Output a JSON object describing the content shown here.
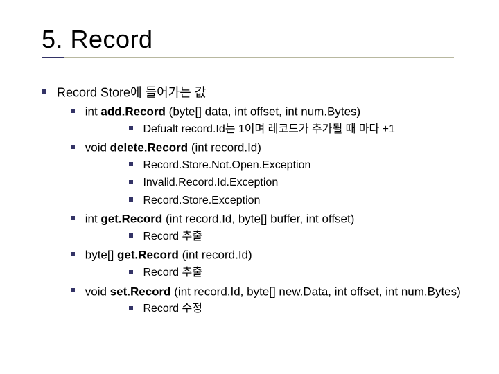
{
  "title": "5. Record",
  "lvl0": {
    "text": "Record Store에 들어가는 값"
  },
  "items": [
    {
      "sig_pre": "int ",
      "method": "add.Record",
      "sig_post": " (byte[] data, int offset, int num.Bytes)",
      "sub": [
        "Defualt record.Id는 1이며 레코드가 추가될 때 마다 +1"
      ]
    },
    {
      "sig_pre": "void ",
      "method": "delete.Record",
      "sig_post": " (int record.Id)",
      "sub": [
        "Record.Store.Not.Open.Exception",
        "Invalid.Record.Id.Exception",
        "Record.Store.Exception"
      ]
    },
    {
      "sig_pre": "int ",
      "method": "get.Record",
      "sig_post": " (int record.Id, byte[] buffer, int offset)",
      "sub": [
        "Record 추출"
      ]
    },
    {
      "sig_pre": "byte[] ",
      "method": "get.Record",
      "sig_post": " (int record.Id)",
      "sub": [
        "Record 추출"
      ]
    },
    {
      "sig_pre": "void ",
      "method": "set.Record",
      "sig_post": " (int record.Id, byte[] new.Data, int offset, int num.Bytes)",
      "sub": [
        "Record 수정"
      ]
    }
  ]
}
